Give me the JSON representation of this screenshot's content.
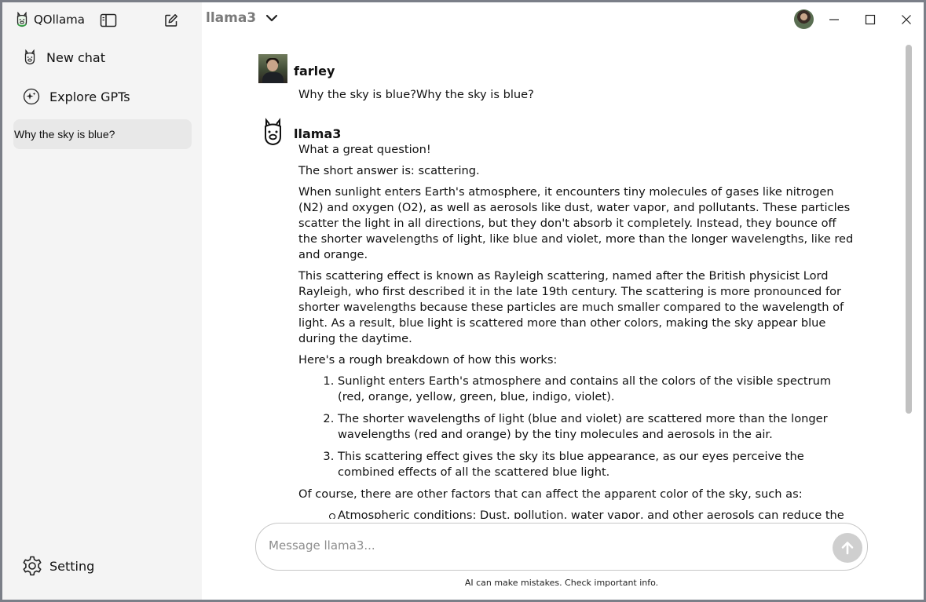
{
  "app": {
    "title": "QOllama"
  },
  "sidebar": {
    "new_chat": "New chat",
    "explore": "Explore GPTs",
    "history": [
      "Why the sky is blue?"
    ],
    "setting": "Setting"
  },
  "header": {
    "model": "llama3"
  },
  "messages": {
    "user": {
      "author": "farley",
      "text": "Why the sky is blue?Why the sky is blue?"
    },
    "bot": {
      "author": "llama3",
      "p1": "What a great question!",
      "p2": "The short answer is: scattering.",
      "p3": "When sunlight enters Earth's atmosphere, it encounters tiny molecules of gases like nitrogen (N2) and oxygen (O2), as well as aerosols like dust, water vapor, and pollutants. These particles scatter the light in all directions, but they don't absorb it completely. Instead, they bounce off the shorter wavelengths of light, like blue and violet, more than the longer wavelengths, like red and orange.",
      "p4": "This scattering effect is known as Rayleigh scattering, named after the British physicist Lord Rayleigh, who first described it in the late 19th century. The scattering is more pronounced for shorter wavelengths because these particles are much smaller compared to the wavelength of light. As a result, blue light is scattered more than other colors, making the sky appear blue during the daytime.",
      "p5": "Here's a rough breakdown of how this works:",
      "steps": [
        "Sunlight enters Earth's atmosphere and contains all the colors of the visible spectrum (red, orange, yellow, green, blue, indigo, violet).",
        "The shorter wavelengths of light (blue and violet) are scattered more than the longer wavelengths (red and orange) by the tiny molecules and aerosols in the air.",
        "This scattering effect gives the sky its blue appearance, as our eyes perceive the combined effects of all the scattered blue light."
      ],
      "p6": "Of course, there are other factors that can affect the apparent color of the sky, such as:",
      "factors": [
        "Atmospheric conditions: Dust, pollution, water vapor, and other aerosols can reduce the blue color or make it appear more hazy."
      ]
    }
  },
  "composer": {
    "placeholder": "Message llama3...",
    "disclaimer": "AI can make mistakes. Check important info."
  },
  "icons": {
    "app_logo": "llama-icon",
    "toggle": "sidebar-toggle-icon",
    "compose": "compose-icon",
    "explore": "sparkle-icon",
    "setting": "gear-icon",
    "dropdown": "chevron-down-icon",
    "send": "arrow-up-icon"
  },
  "colors": {
    "sidebar_bg": "#f4f4f4",
    "history_active_bg": "#e8e8e8",
    "send_button": "#cfcfcf",
    "model_text": "#7a7a7a"
  }
}
